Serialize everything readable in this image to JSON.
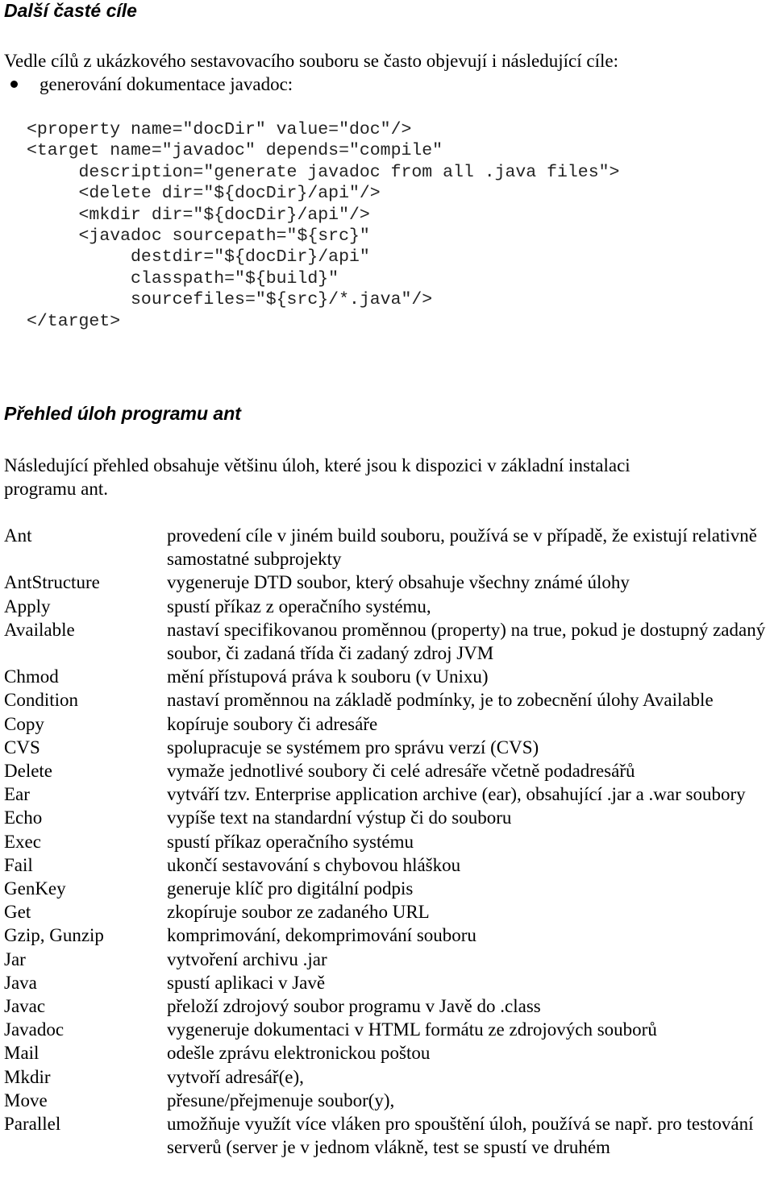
{
  "section1": {
    "heading": "Další časté cíle",
    "intro": "Vedle cílů z ukázkového sestavovacího souboru se často objevují i následující cíle:",
    "bullets": [
      "generování dokumentace javadoc:"
    ],
    "code_lines": [
      "<property name=\"docDir\" value=\"doc\"/>",
      "<target name=\"javadoc\" depends=\"compile\"",
      "     description=\"generate javadoc from all .java files\">",
      "     <delete dir=\"${docDir}/api\"/>",
      "     <mkdir dir=\"${docDir}/api\"/>",
      "     <javadoc sourcepath=\"${src}\"",
      "          destdir=\"${docDir}/api\"",
      "          classpath=\"${build}\"",
      "          sourcefiles=\"${src}/*.java\"/>",
      "</target>"
    ]
  },
  "section2": {
    "heading": "Přehled úloh programu ant",
    "intro_line1": "Následující přehled obsahuje většinu úloh, které jsou k dispozici v základní instalaci",
    "intro_line2": "programu ant.",
    "tasks": [
      {
        "name": "Ant",
        "desc": "provedení cíle v jiném build souboru, používá se v případě, že existují relativně samostatné subprojekty"
      },
      {
        "name": "AntStructure",
        "desc": "vygeneruje DTD soubor, který obsahuje všechny známé úlohy"
      },
      {
        "name": "Apply",
        "desc": "spustí příkaz z operačního systému,"
      },
      {
        "name": "Available",
        "desc": "nastaví specifikovanou proměnnou (property) na true, pokud je dostupný zadaný soubor, či zadaná třída či zadaný zdroj JVM"
      },
      {
        "name": "Chmod",
        "desc": "mění přístupová práva k souboru (v Unixu)"
      },
      {
        "name": "Condition",
        "desc": "nastaví proměnnou na základě podmínky, je to zobecnění úlohy Available"
      },
      {
        "name": "Copy",
        "desc": "kopíruje soubory či adresáře"
      },
      {
        "name": "CVS",
        "desc": "spolupracuje se systémem pro správu verzí (CVS)"
      },
      {
        "name": "Delete",
        "desc": "vymaže jednotlivé soubory či celé adresáře včetně podadresářů"
      },
      {
        "name": "Ear",
        "desc": "vytváří tzv. Enterprise application archive (ear), obsahující .jar a .war soubory"
      },
      {
        "name": "Echo",
        "desc": "vypíše text na standardní výstup či do souboru"
      },
      {
        "name": "Exec",
        "desc": "spustí příkaz operačního systému"
      },
      {
        "name": "Fail",
        "desc": "ukončí sestavování s chybovou hláškou"
      },
      {
        "name": "GenKey",
        "desc": "generuje klíč pro digitální podpis"
      },
      {
        "name": "Get",
        "desc": "zkopíruje soubor ze zadaného URL"
      },
      {
        "name": "Gzip, Gunzip",
        "desc": "komprimování, dekomprimování souboru"
      },
      {
        "name": "Jar",
        "desc": "vytvoření archivu .jar"
      },
      {
        "name": "Java",
        "desc": "spustí aplikaci v Javě"
      },
      {
        "name": "Javac",
        "desc": "přeloží zdrojový soubor programu v Javě do .class"
      },
      {
        "name": "Javadoc",
        "desc": "vygeneruje dokumentaci v HTML formátu ze zdrojových souborů"
      },
      {
        "name": "Mail",
        "desc": "odešle zprávu elektronickou poštou"
      },
      {
        "name": "Mkdir",
        "desc": "vytvoří adresář(e),"
      },
      {
        "name": "Move",
        "desc": "přesune/přejmenuje soubor(y),"
      },
      {
        "name": "Parallel",
        "desc": "umožňuje využít více vláken pro spouštění úloh, používá se např. pro testování serverů (server je v jednom vlákně, test se spustí ve druhém"
      }
    ]
  }
}
